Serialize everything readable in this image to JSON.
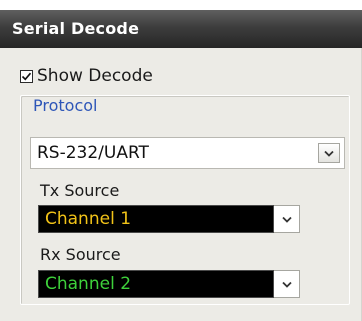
{
  "panel": {
    "title": "Serial Decode"
  },
  "show_decode": {
    "label": "Show Decode",
    "checked": true
  },
  "protocol_group": {
    "label": "Protocol",
    "selected": "RS-232/UART"
  },
  "tx_source": {
    "label": "Tx Source",
    "selected": "Channel 1",
    "color": "#f2c318"
  },
  "rx_source": {
    "label": "Rx Source",
    "selected": "Channel 2",
    "color": "#3ed13b"
  },
  "icons": {
    "dropdown": "chevron-down-icon",
    "checkbox": "checkmark-icon"
  }
}
